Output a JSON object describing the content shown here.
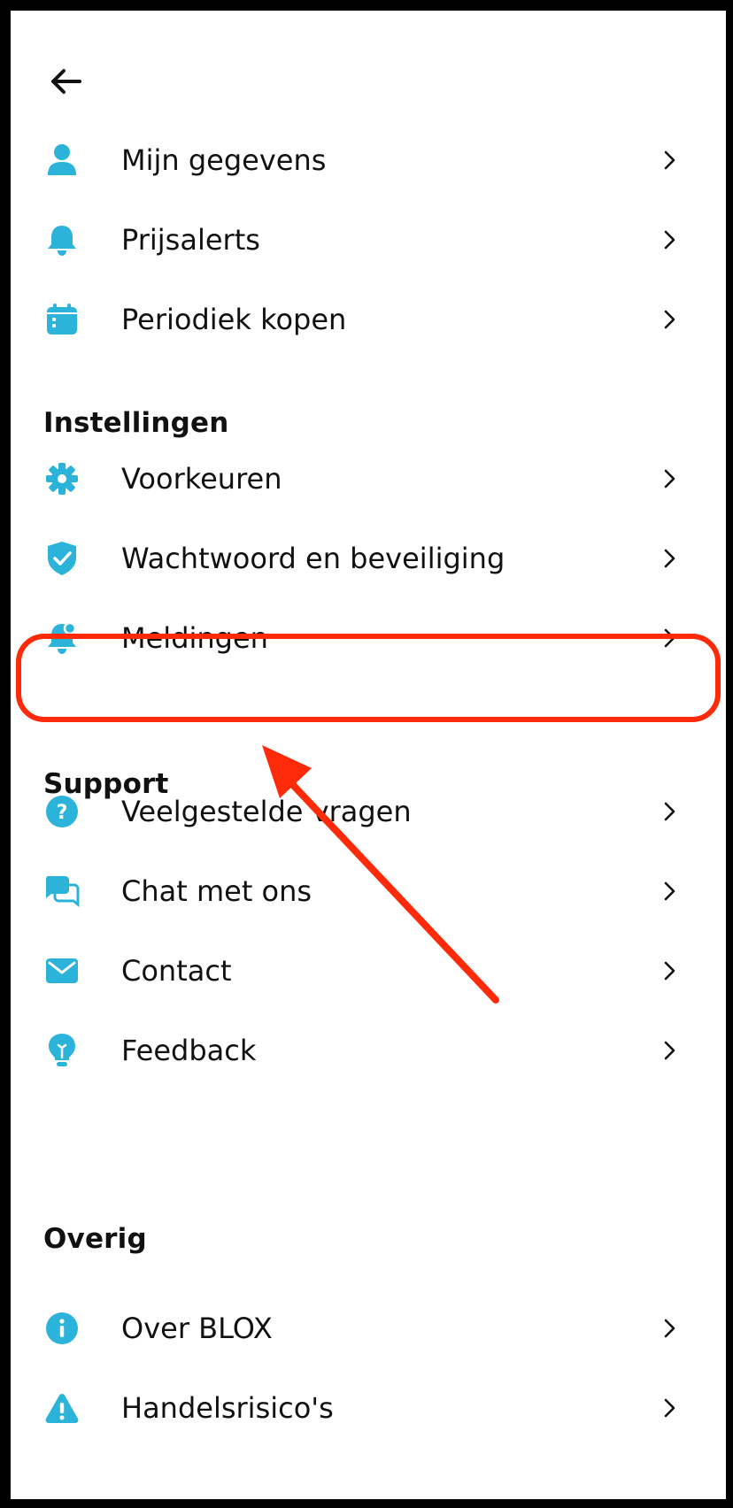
{
  "colors": {
    "accent": "#2bb3d9",
    "annotation": "#ff2a0a",
    "text": "#111111"
  },
  "header": {
    "back_icon": "arrow-left-icon"
  },
  "account": {
    "items": [
      {
        "label": "Mijn gegevens",
        "icon": "person-icon"
      },
      {
        "label": "Prijsalerts",
        "icon": "bell-icon"
      },
      {
        "label": "Periodiek kopen",
        "icon": "calendar-icon"
      }
    ]
  },
  "instellingen": {
    "title": "Instellingen",
    "items": [
      {
        "label": "Voorkeuren",
        "icon": "gear-icon"
      },
      {
        "label": "Wachtwoord en beveiliging",
        "icon": "shield-check-icon"
      },
      {
        "label": "Meldingen",
        "icon": "notification-bell-icon"
      }
    ]
  },
  "support": {
    "title": "Support",
    "items": [
      {
        "label": "Veelgestelde vragen",
        "icon": "question-circle-icon"
      },
      {
        "label": "Chat met ons",
        "icon": "chat-bubbles-icon"
      },
      {
        "label": "Contact",
        "icon": "envelope-icon"
      },
      {
        "label": "Feedback",
        "icon": "lightbulb-icon"
      }
    ]
  },
  "overig": {
    "title": "Overig",
    "items": [
      {
        "label": "Over BLOX",
        "icon": "info-circle-icon"
      },
      {
        "label": "Handelsrisico's",
        "icon": "warning-triangle-icon"
      }
    ]
  }
}
